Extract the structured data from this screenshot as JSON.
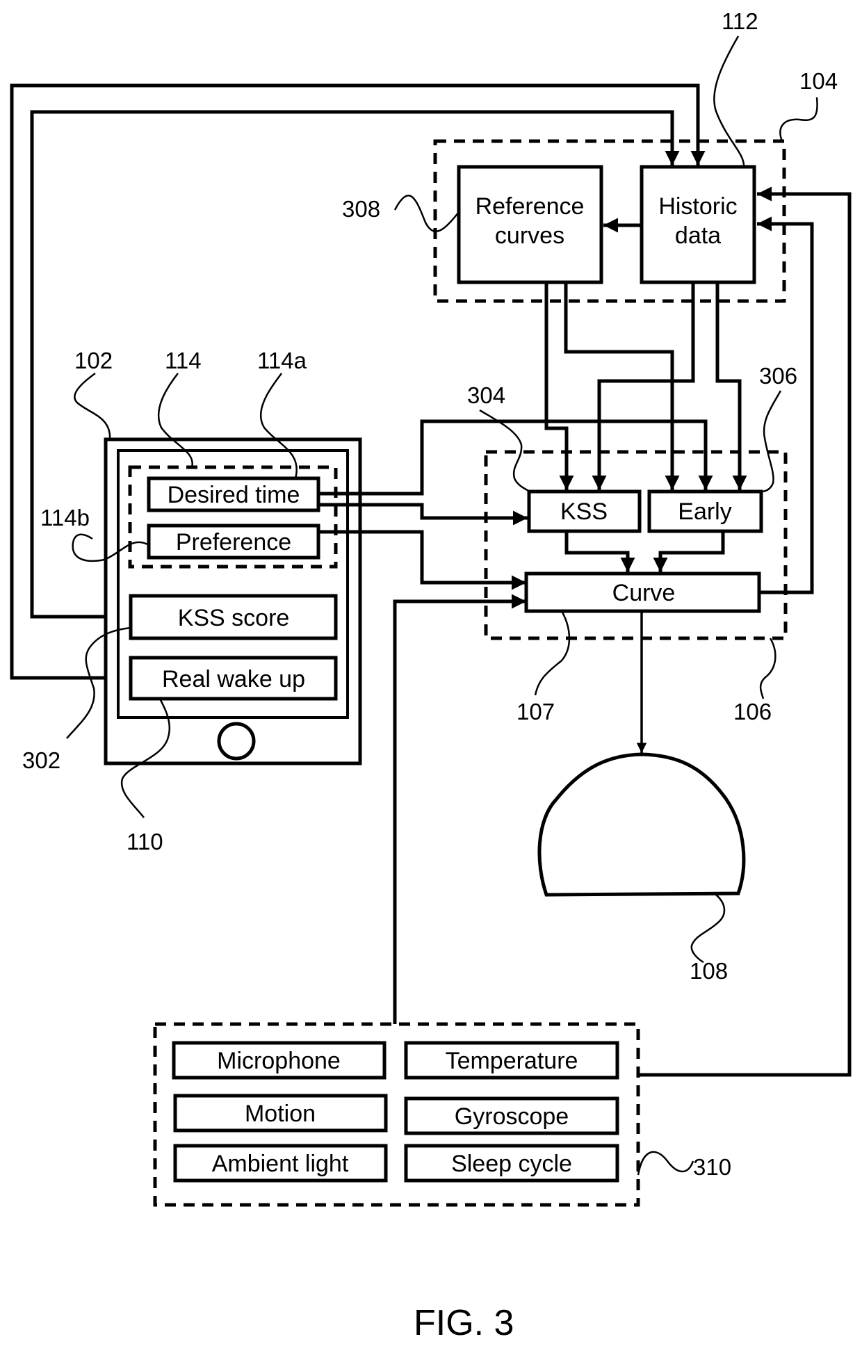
{
  "figure": {
    "caption": "FIG. 3"
  },
  "device": {
    "ref": "102",
    "input_group_ref": "114",
    "desired_time": {
      "label": "Desired time",
      "ref": "114a"
    },
    "preference": {
      "label": "Preference",
      "ref": "114b"
    },
    "kss_score": {
      "label": "KSS score",
      "ref": "302"
    },
    "real_wake_up": {
      "label": "Real wake up",
      "ref": "110"
    }
  },
  "storage": {
    "ref": "104",
    "reference_curves": {
      "line1": "Reference",
      "line2": "curves",
      "ref": "308"
    },
    "historic_data": {
      "line1": "Historic",
      "line2": "data",
      "ref": "112"
    }
  },
  "processor": {
    "ref": "106",
    "kss": {
      "label": "KSS",
      "ref": "304"
    },
    "early": {
      "label": "Early",
      "ref": "306"
    },
    "curve": {
      "label": "Curve",
      "ref": "107"
    }
  },
  "light": {
    "ref": "108"
  },
  "sensors": {
    "ref": "310",
    "items": [
      "Microphone",
      "Temperature",
      "Motion",
      "Gyroscope",
      "Ambient light",
      "Sleep cycle"
    ]
  }
}
